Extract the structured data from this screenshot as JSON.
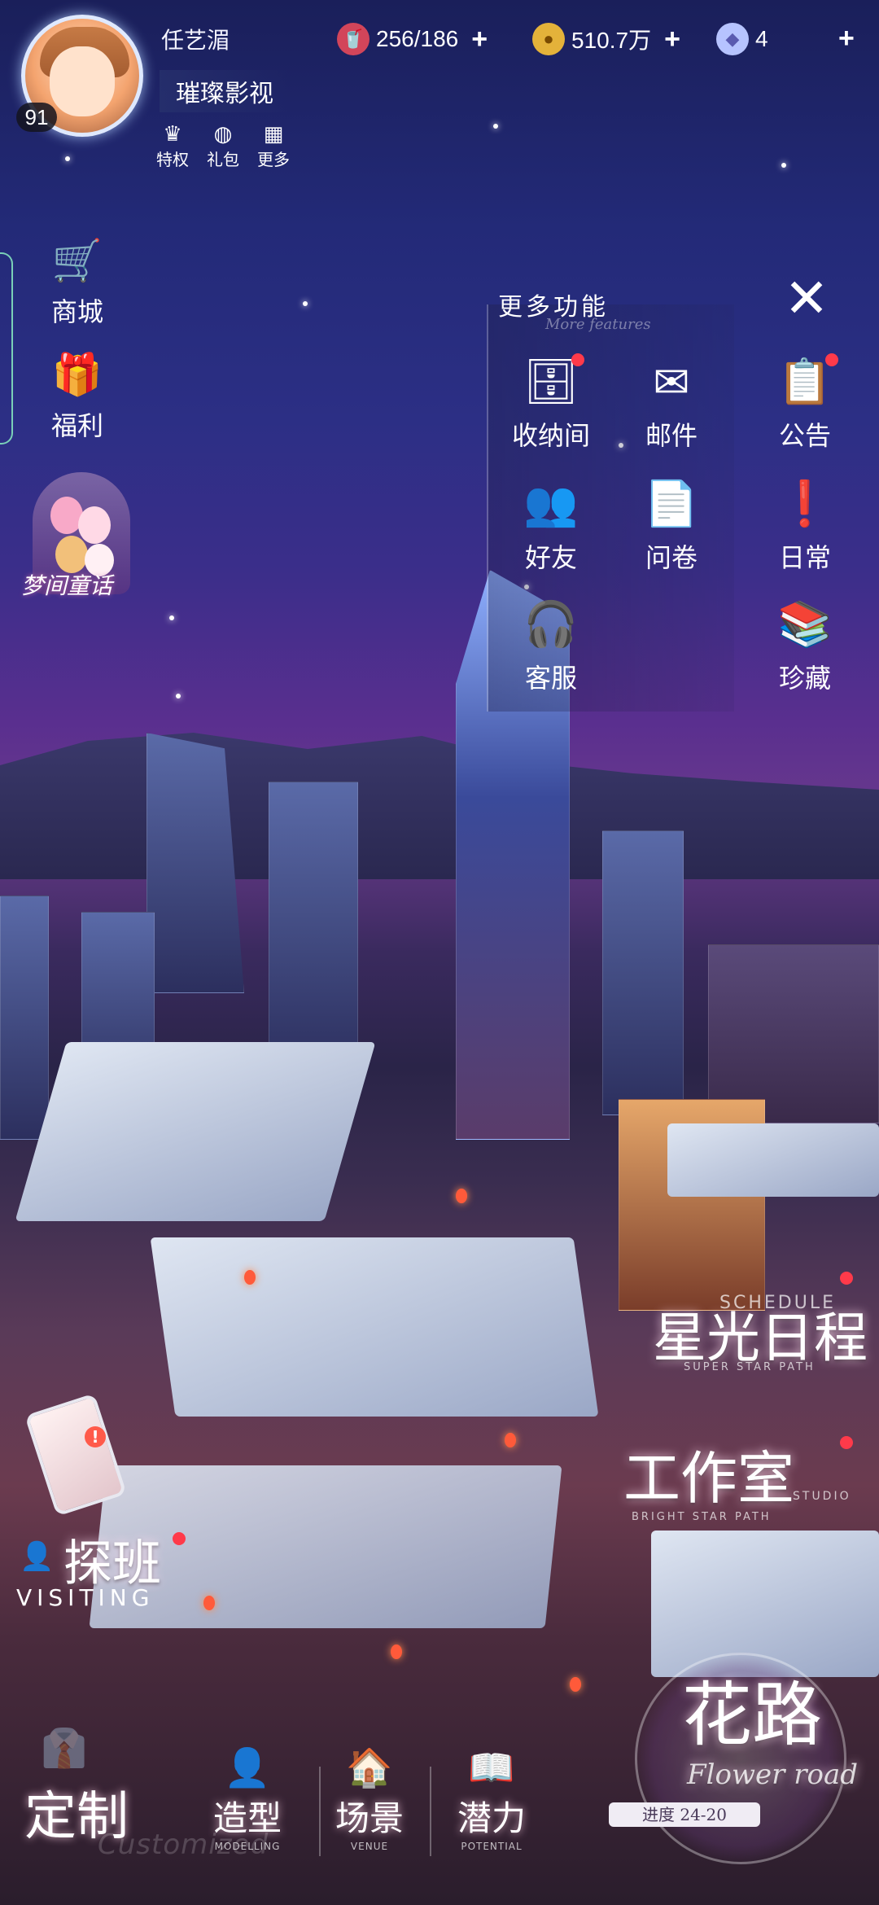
{
  "header": {
    "player_name": "任艺湄",
    "level": "91",
    "company_name": "璀璨影视",
    "quick_links": [
      {
        "label": "特权",
        "icon": "crown-icon"
      },
      {
        "label": "礼包",
        "icon": "wechat-icon"
      },
      {
        "label": "更多",
        "icon": "grid-icon"
      }
    ],
    "resources": [
      {
        "value": "256/186",
        "icon": "drink-icon"
      },
      {
        "value": "510.7万",
        "icon": "gold-coin-icon"
      },
      {
        "value": "4",
        "icon": "diamond-icon"
      }
    ]
  },
  "left_menu": {
    "shop": "商城",
    "welfare": "福利",
    "dream_tale": "梦间童话"
  },
  "more_panel": {
    "title": "更多功能",
    "subtitle": "More features",
    "items": [
      {
        "label": "收纳间",
        "icon": "storage-box-icon",
        "badge": true
      },
      {
        "label": "邮件",
        "icon": "mail-icon",
        "badge": false
      },
      {
        "label": "公告",
        "icon": "notice-board-icon",
        "badge": true
      },
      {
        "label": "好友",
        "icon": "friends-icon",
        "badge": false
      },
      {
        "label": "问卷",
        "icon": "survey-icon",
        "badge": false
      },
      {
        "label": "日常",
        "icon": "daily-icon",
        "badge": false
      },
      {
        "label": "客服",
        "icon": "support-icon",
        "badge": false
      },
      {
        "label": "珍藏",
        "icon": "collection-books-icon",
        "badge": false
      }
    ]
  },
  "feature_buttons": {
    "schedule": {
      "label": "星光日程",
      "sub": "SCHEDULE",
      "sub2": "SUPER STAR PATH"
    },
    "studio": {
      "label": "工作室",
      "sub": "STUDIO",
      "sub2": "BRIGHT STAR PATH"
    },
    "visiting": {
      "label": "探班",
      "sub": "VISITING"
    },
    "flower_road": {
      "label": "花路",
      "sub": "Flower road",
      "progress": "进度 24-20"
    }
  },
  "bottom_nav": [
    {
      "label": "定制",
      "sub": "Customized",
      "icon": "suit-icon"
    },
    {
      "label": "造型",
      "sub": "MODELLING",
      "icon": "bust-icon"
    },
    {
      "label": "场景",
      "sub": "VENUE",
      "icon": "house-icon"
    },
    {
      "label": "潜力",
      "sub": "POTENTIAL",
      "icon": "book-icon"
    }
  ]
}
